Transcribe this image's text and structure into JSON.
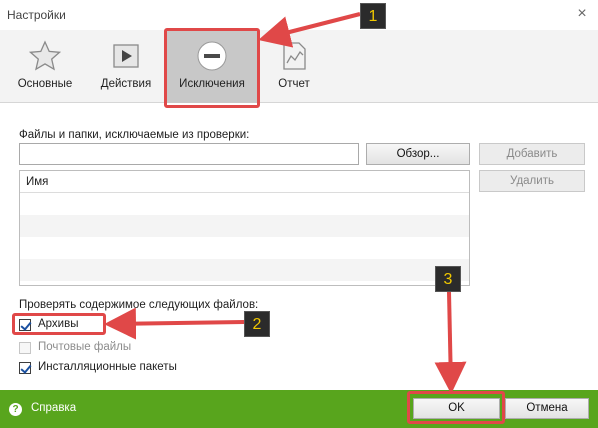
{
  "window": {
    "title": "Настройки",
    "close_glyph": "×"
  },
  "tabs": [
    {
      "label": "Основные",
      "icon": "star-icon"
    },
    {
      "label": "Действия",
      "icon": "play-icon"
    },
    {
      "label": "Исключения",
      "icon": "minus-circle-icon"
    },
    {
      "label": "Отчет",
      "icon": "report-chart-icon"
    }
  ],
  "exclusions": {
    "label": "Файлы и папки, исключаемые из проверки:",
    "path_value": "",
    "browse_label": "Обзор...",
    "add_label": "Добавить",
    "remove_label": "Удалить",
    "list_header": "Имя",
    "rows": []
  },
  "scan_contents": {
    "label": "Проверять содержимое следующих файлов:",
    "options": [
      {
        "label": "Архивы",
        "checked": true,
        "enabled": true
      },
      {
        "label": "Почтовые файлы",
        "checked": false,
        "enabled": false
      },
      {
        "label": "Инсталляционные пакеты",
        "checked": true,
        "enabled": true
      }
    ]
  },
  "footer": {
    "help_label": "Справка",
    "ok_label": "OK",
    "cancel_label": "Отмена"
  },
  "annotations": [
    {
      "number": "1"
    },
    {
      "number": "2"
    },
    {
      "number": "3"
    }
  ],
  "colors": {
    "footer": "#58a51d",
    "callout": "#e04848",
    "badge_text": "#f0c800"
  }
}
